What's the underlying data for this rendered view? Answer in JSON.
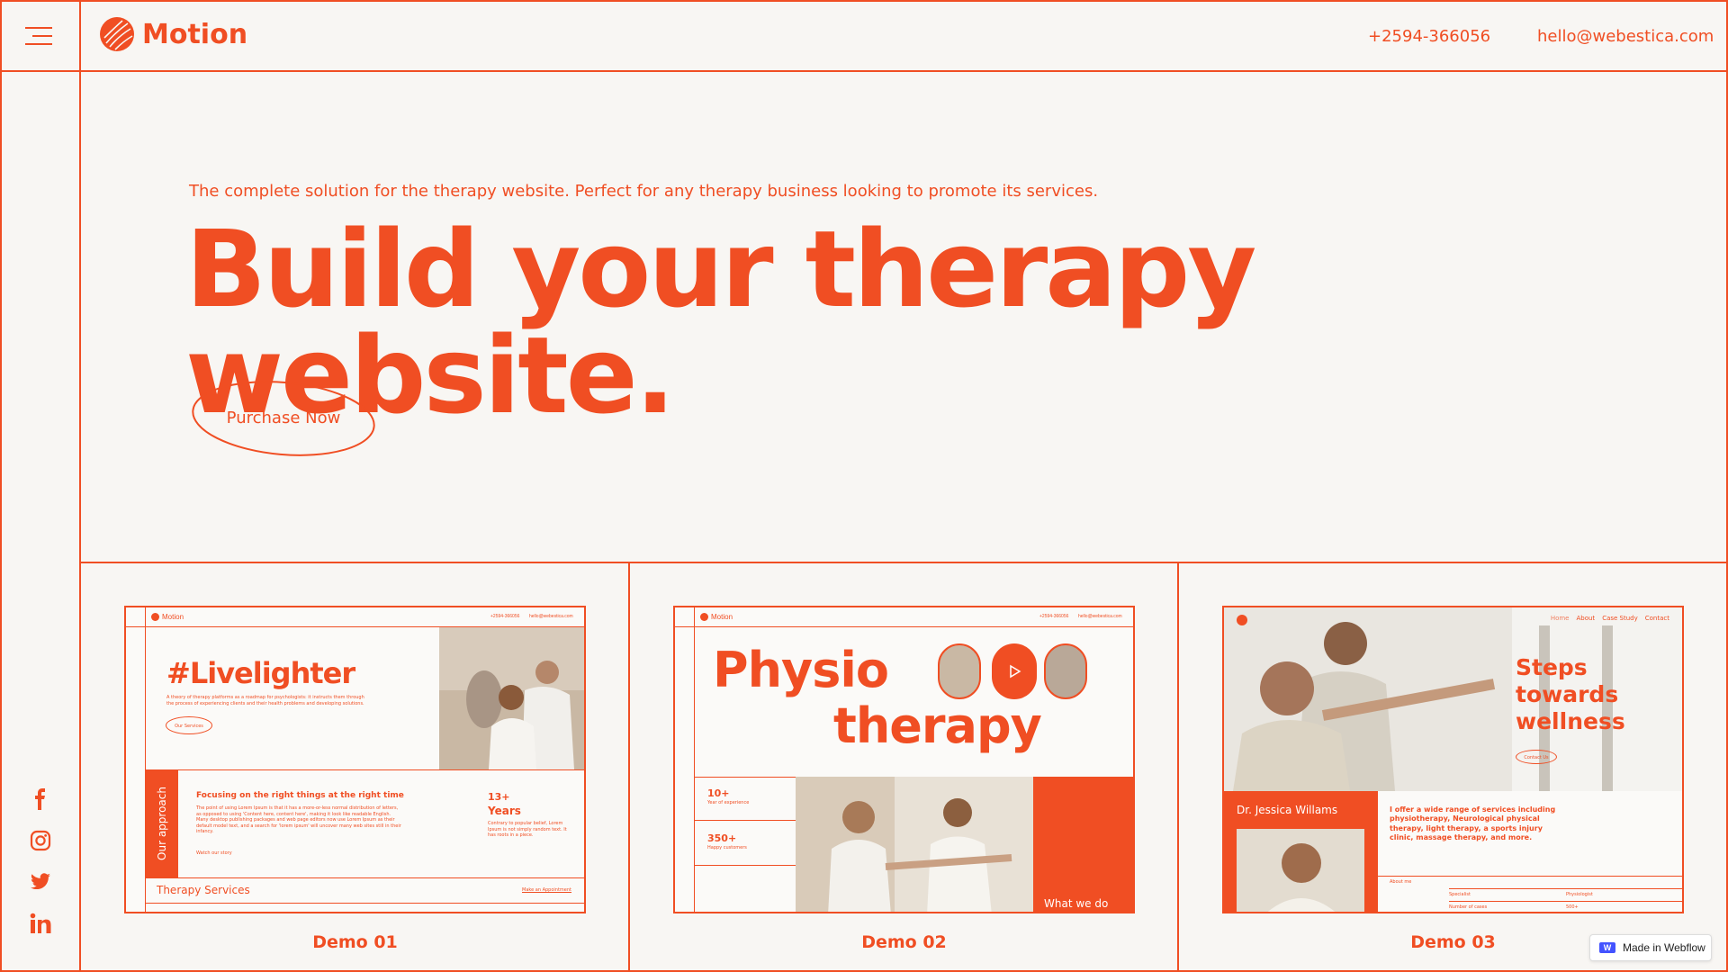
{
  "header": {
    "logo_text": "Motion",
    "phone": "+2594-366056",
    "email": "hello@webestica.com"
  },
  "hero": {
    "subtitle": "The complete solution for the therapy website. Perfect for any therapy business looking to promote its services.",
    "title": "Build your therapy website.",
    "cta_label": "Purchase Now"
  },
  "social": [
    "facebook-icon",
    "instagram-icon",
    "twitter-icon",
    "linkedin-icon"
  ],
  "demos": [
    {
      "label": "Demo 01",
      "mini": {
        "logo": "Motion",
        "phone": "+2594-366056",
        "email": "hello@webestica.com",
        "headline": "#Livelighter",
        "body": "A theory of therapy platforms as a roadmap for psychologists: it instructs them through the process of experiencing clients and their health problems and developing solutions.",
        "button": "Our Services",
        "vertical_label": "Our approach",
        "focus_title": "Focusing on the right things at the right time",
        "focus_body": "The point of using Lorem Ipsum is that it has a more-or-less normal distribution of letters, as opposed to using 'Content here, content here', making it look like readable English. Many desktop publishing packages and web page editors now use Lorem Ipsum as their default model text, and a search for 'lorem ipsum' will uncover many web sites still in their infancy.",
        "watch": "Watch our story",
        "years_num": "13+",
        "years_label": "Years",
        "years_body": "Contrary to popular belief, Lorem Ipsum is not simply random text. It has roots in a piece.",
        "services": "Therapy Services",
        "appointment": "Make an Appointment"
      }
    },
    {
      "label": "Demo 02",
      "mini": {
        "logo": "Motion",
        "phone": "+2594-366056",
        "email": "hello@webestica.com",
        "headline_1": "Physio",
        "headline_2": "therapy",
        "stat1_num": "10+",
        "stat1_label": "Year of experience",
        "stat2_num": "350+",
        "stat2_label": "Happy customers",
        "what_we_do": "What we do"
      }
    },
    {
      "label": "Demo 03",
      "mini": {
        "nav": [
          "Home",
          "About",
          "Case Study",
          "Contact"
        ],
        "headline": "Steps towards wellness",
        "button": "Contact Us",
        "doctor": "Dr. Jessica Willams",
        "services": "I offer a wide range of services including physiotherapy, Neurological physical therapy, light therapy, a sports injury clinic, massage therapy, and more.",
        "about": "About me",
        "spec_k": "Specialist",
        "spec_v": "Physiologist",
        "cases_k": "Number of cases",
        "cases_v": "500+"
      }
    }
  ],
  "badge": "Made in Webflow",
  "colors": {
    "accent": "#f04e23",
    "background": "#f8f6f3"
  }
}
